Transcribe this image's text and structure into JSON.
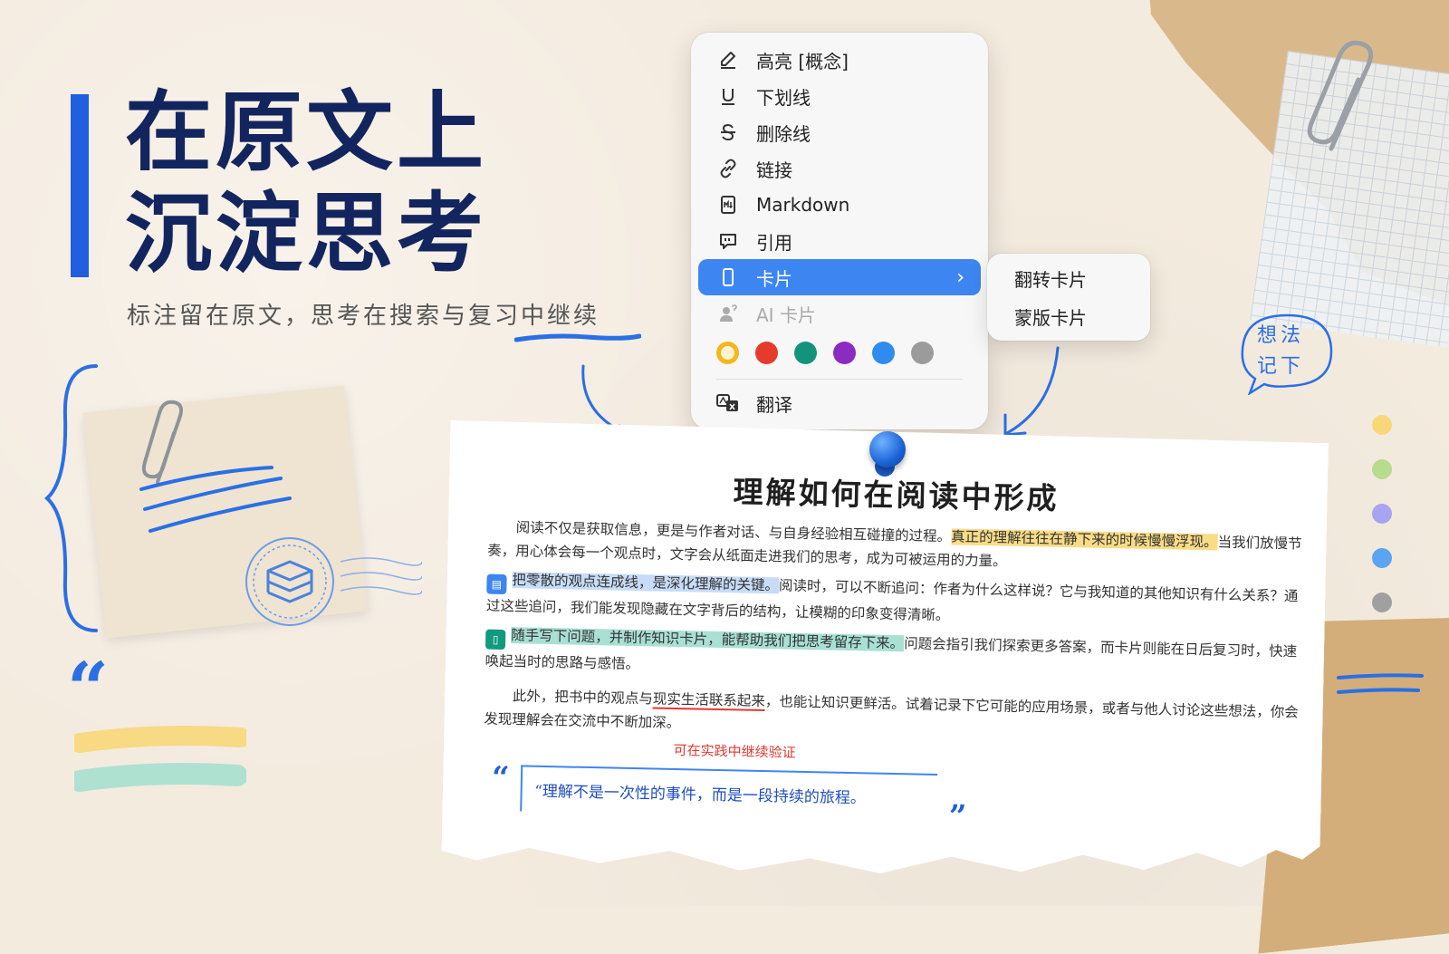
{
  "hero": {
    "title_line1": "在原文上",
    "title_line2": "沉淀思考",
    "subtitle": "标注留在原文，思考在搜索与复习中继续"
  },
  "context_menu": {
    "items": [
      {
        "label": "高亮 [概念]",
        "icon": "pen-icon"
      },
      {
        "label": "下划线",
        "icon": "underline-icon"
      },
      {
        "label": "删除线",
        "icon": "strikethrough-icon"
      },
      {
        "label": "链接",
        "icon": "link-icon"
      },
      {
        "label": "Markdown",
        "icon": "markdown-icon"
      },
      {
        "label": "引用",
        "icon": "quote-bubble-icon"
      },
      {
        "label": "卡片",
        "icon": "card-icon",
        "state": "active"
      },
      {
        "label": "AI 卡片",
        "icon": "ai-person-icon",
        "state": "disabled"
      }
    ],
    "colors": [
      "#f6b71a",
      "#e53a2c",
      "#14937c",
      "#8a2bc2",
      "#2f8bef",
      "#9b9b9b"
    ],
    "translate_label": "翻译"
  },
  "submenu": {
    "items": [
      "翻转卡片",
      "蒙版卡片"
    ]
  },
  "article": {
    "title": "理解如何在阅读中形成",
    "p1_a": "阅读不仅是获取信息，更是与作者对话、与自身经验相互碰撞的过程。",
    "p1_hl": "真正的理解往往在静下来的时候慢慢浮现。",
    "p1_b": "当我们放慢节奏，用心体会每一个观点时，文字会从纸面走进我们的思考，成为可被运用的力量。",
    "p2_hl": "把零散的观点连成线，是深化理解的关键。",
    "p2_b": "阅读时，可以不断追问：作者为什么这样说？它与我知道的其他知识有什么关系？通过这些追问，我们能发现隐藏在文字背后的结构，让模糊的印象变得清晰。",
    "p3_hl": "随手写下问题，并制作知识卡片，能帮助我们把思考留存下来。",
    "p3_b": "问题会指引我们探索更多答案，而卡片则能在日后复习时，快速唤起当时的思路与感悟。",
    "p4_a": "此外，把书中的观点与",
    "p4_ul": "现实生活联系起来",
    "p4_b": "，也能让知识更鲜活。试着记录下它可能的应用场景，或者与他人讨论这些想法，你会发现理解会在交流中不断加深。",
    "annotation": "可在实践中继续验证",
    "quote": "“理解不是一次性的事件，而是一段持续的旅程。",
    "quote_open": "“",
    "quote_close": "”"
  },
  "idea_bubble": {
    "line1": "想法",
    "line2": "记下"
  },
  "side_dots": [
    "#f8d77a",
    "#b7dc8e",
    "#a9a4ef",
    "#5aa4f2",
    "#a0a0a0"
  ],
  "decor": {
    "quote_mark": "“"
  }
}
